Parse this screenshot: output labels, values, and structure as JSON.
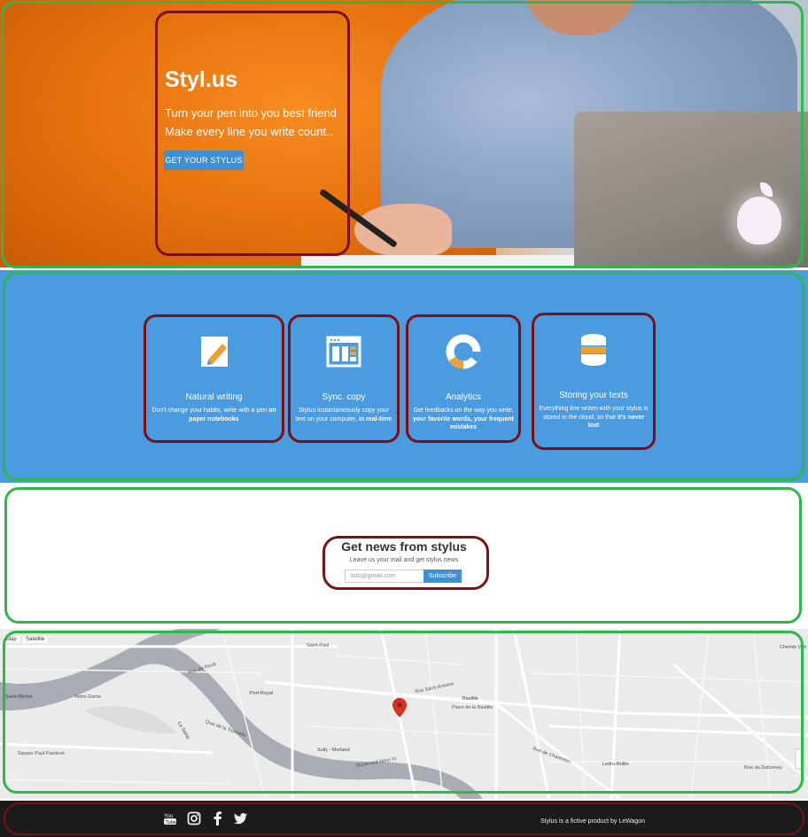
{
  "hero": {
    "title": "Styl.us",
    "line1": "Turn your pen into you best friend",
    "line2": "Make every line you write count..",
    "cta_label": "GET YOUR STYLUS"
  },
  "features": [
    {
      "title": "Natural writing",
      "desc_plain": "Don't change your habits, write with a pen ",
      "desc_bold": "on paper notebooks",
      "desc_after": "",
      "icon": "pencil-icon"
    },
    {
      "title": "Sync. copy",
      "desc_plain": "Stylus instantaneously copy your text on your computer, ",
      "desc_bold": "in real-time",
      "desc_after": "",
      "icon": "window-layout-icon"
    },
    {
      "title": "Analytics",
      "desc_plain": "Get feedbacks on the way you write, ",
      "desc_bold": "your favorite words, your frequent mistakes",
      "desc_after": "",
      "icon": "donut-chart-icon"
    },
    {
      "title": "Storing your texts",
      "desc_plain": "Everything line writen with your stylus is stored in the cloud, so that ",
      "desc_bold": "it's never lost",
      "desc_after": "",
      "icon": "database-icon"
    }
  ],
  "newsletter": {
    "title": "Get news from stylus",
    "subtitle": "Leave us your mail and get stylus news",
    "email_placeholder": "bob@gmail.com",
    "button_label": "Subscribe"
  },
  "map": {
    "type_map": "Map",
    "type_satellite": "Satellite",
    "labels": [
      "Saint-Paul",
      "Rue Saint-Antoine",
      "Bastille",
      "Place de la Bastille",
      "Port-Royal",
      "Rue de Rivoli",
      "Sully - Morland",
      "Boulevard Henri IV",
      "Ledru-Rollin",
      "Rue de Charenton",
      "Quai de la Tournelle",
      "Square Paul Painlevé",
      "Rue du Dahomey",
      "Chemin Vert",
      "Saint-Michel",
      "Notre-Dame",
      "La Seine"
    ],
    "pin_icon": "map-pin-icon"
  },
  "footer": {
    "text": "Stylus is a fictive product by LeWagon",
    "social": [
      "youtube-icon",
      "instagram-icon",
      "facebook-icon",
      "twitter-icon"
    ]
  },
  "colors": {
    "accent_blue": "#4a9be0",
    "button_blue": "#3f8fd7",
    "hero_orange": "#f07a14",
    "annotation_green": "#2db84a",
    "annotation_red": "#7b1116",
    "icon_orange": "#f0a030"
  }
}
